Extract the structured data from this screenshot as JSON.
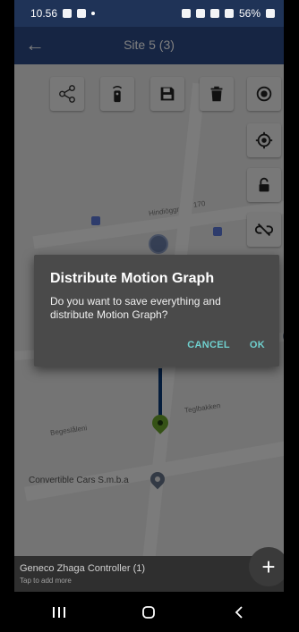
{
  "status_bar": {
    "time": "10.56",
    "battery": "56%"
  },
  "app_bar": {
    "title": "Site 5 (3)",
    "back_icon": "arrow-back-icon"
  },
  "toolbar": {
    "buttons": [
      {
        "name": "share-icon"
      },
      {
        "name": "remote-icon"
      },
      {
        "name": "save-icon"
      },
      {
        "name": "delete-icon"
      },
      {
        "name": "target-icon"
      }
    ],
    "side_buttons": [
      {
        "name": "locate-icon"
      },
      {
        "name": "lock-icon"
      },
      {
        "name": "unlink-icon"
      }
    ]
  },
  "map": {
    "street_label": "Hindiöggr",
    "street_number": "170",
    "street_label_2": "Teglbakken",
    "street_label_3": "Begeslåleni",
    "poi": "Convertible Cars S.m.b.a"
  },
  "dialog": {
    "title": "Distribute Motion Graph",
    "message": "Do you want to save everything and distribute Motion Graph?",
    "cancel_label": "CANCEL",
    "ok_label": "OK"
  },
  "snackbar": {
    "title": "Geneco Zhaga Controller (1)",
    "subtitle": "Tap to add more"
  },
  "fab": {
    "label": "+"
  },
  "colors": {
    "app_bar": "#2c4a86",
    "status_bar": "#1f3357",
    "accent": "#6fd0ce"
  }
}
